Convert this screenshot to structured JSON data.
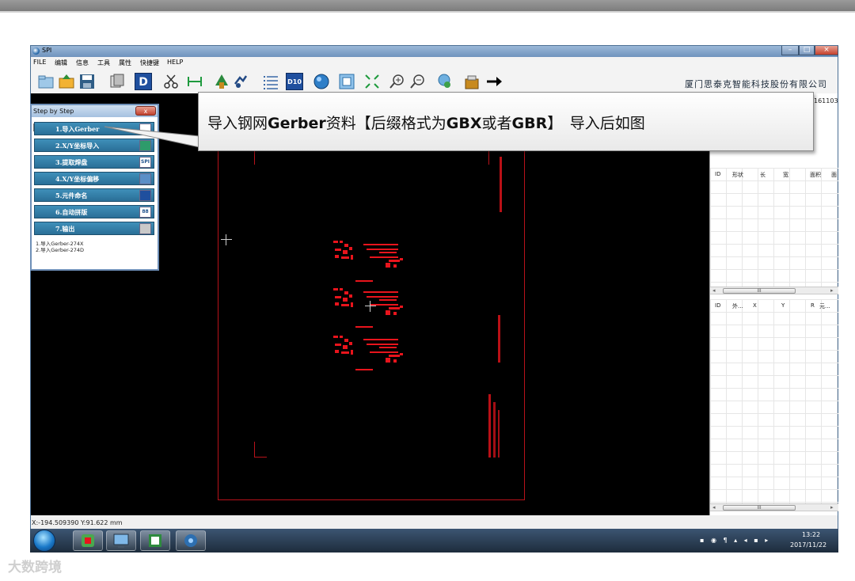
{
  "window": {
    "title": "SPI",
    "company": "厦门思泰克智能科技股份有限公司",
    "side_number": "161103"
  },
  "menu": [
    "FILE",
    "编辑",
    "信息",
    "工具",
    "属性",
    "快捷键",
    "HELP"
  ],
  "toolbar": {
    "icons": [
      "open-folder-icon",
      "import-icon",
      "save-icon",
      "layers-icon",
      "d-code-icon",
      "scissors-icon",
      "measure-icon",
      "pad-tool-icon",
      "rotate-icon",
      "list-icon",
      "d10-icon",
      "circle-icon",
      "frame-icon",
      "fit-icon",
      "zoom-in-icon",
      "zoom-out-icon",
      "pan-icon",
      "export-icon",
      "arrow-right-icon"
    ],
    "d_label": "D",
    "d10_label": "D10"
  },
  "step_panel": {
    "title": "Step by Step",
    "close_label": "x",
    "steps": [
      {
        "label": "1.导入Gerber",
        "icon": ""
      },
      {
        "label": "2.X/Y坐标导入",
        "icon": ""
      },
      {
        "label": "3.提取焊盘",
        "icon": "SPI"
      },
      {
        "label": "4.X/Y坐标偏移",
        "icon": ""
      },
      {
        "label": "5.元件命名",
        "icon": ""
      },
      {
        "label": "6.自动拼版",
        "icon": "88"
      },
      {
        "label": "7.输出",
        "icon": ""
      }
    ],
    "log": [
      "1.导入Gerber-274X",
      "2.导入Gerber-274D"
    ]
  },
  "callout": {
    "part1": "导入钢网",
    "bold1": "Gerber",
    "part2": "资料【后缀格式为",
    "bold2": "GBX",
    "part3": "或者",
    "bold3": "GBR",
    "part4": "】　导入后如图"
  },
  "right_panel": {
    "table1_headers": [
      "ID",
      "形状",
      "长",
      "宽",
      "面积",
      "面"
    ],
    "table2_headers": [
      "ID",
      "外...",
      "X",
      "Y",
      "R",
      "元..."
    ],
    "scroll_thumb": "III"
  },
  "status": {
    "coords": "X:-194.509390 Y:91.622 mm"
  },
  "taskbar": {
    "time": "13:22",
    "date": "2017/11/22"
  },
  "watermark": "大数跨境",
  "colors": {
    "pad_red": "#e8141c",
    "outline_red": "#b8121a",
    "step_blue": "#2f7fa9"
  }
}
